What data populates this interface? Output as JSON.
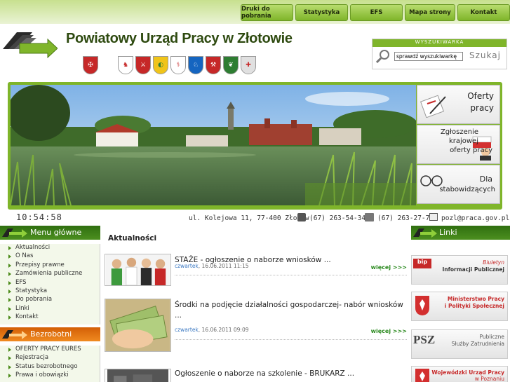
{
  "nav": {
    "items": [
      "Druki do pobrania",
      "Statystyka",
      "EFS",
      "Mapa strony",
      "Kontakt"
    ]
  },
  "header": {
    "title": "Powiatowy Urząd Pracy w Złotowie"
  },
  "search": {
    "heading": "WYSZUKIWARKA",
    "value": "sprawdź wyszukiwarkę",
    "button": "Szukaj"
  },
  "banner": {
    "panels": [
      [
        "Oferty",
        "pracy"
      ],
      [
        "Zgłoszenie",
        "krajowej",
        "oferty pracy"
      ],
      [
        "Dla",
        "stabowidzących"
      ]
    ]
  },
  "info": {
    "time": "10:54:58",
    "address": "ul. Kolejowa 11, 77-400 Złotów",
    "phone": "(67) 263-54-34",
    "fax": "(67) 263-27-79",
    "email": "pozl@praca.gov.pl"
  },
  "menu_main": {
    "heading": "Menu główne",
    "items": [
      "Aktualności",
      "O Nas",
      "Przepisy prawne",
      "Zamówienia publiczne",
      "EFS",
      "Statystyka",
      "Do pobrania",
      "Linki",
      "Kontakt"
    ]
  },
  "menu_unemployed": {
    "heading": "Bezrobotni",
    "items": [
      "OFERTY PRACY EURES",
      "Rejestracja",
      "Status bezrobotnego",
      "Prawa i obowiązki"
    ]
  },
  "news": {
    "heading": "Aktualności",
    "items": [
      {
        "title": "STAŻE - ogłoszenie o naborze wniosków ...",
        "day": "czwartek",
        "datetime": ", 16.06.2011 11:15",
        "more": "więcej >>>"
      },
      {
        "title": "Środki na podjęcie działalności gospodarczej- nabór wniosków ...",
        "day": "czwartek",
        "datetime": ", 16.06.2011 09:09",
        "more": "więcej >>>"
      },
      {
        "title": "Ogłoszenie o naborze na szkolenie - BRUKARZ ...",
        "day": "",
        "datetime": "",
        "more": ""
      }
    ]
  },
  "links": {
    "heading": "Linki",
    "items": [
      {
        "badge": "bip",
        "lines": [
          "Biuletyn",
          "Informacji Publicznej"
        ]
      },
      {
        "badge": "",
        "lines": [
          "Ministerstwo Pracy",
          "i Polityki Społecznej"
        ]
      },
      {
        "badge": "PSZ",
        "lines": [
          "Publiczne",
          "Służby Zatrudnienia"
        ]
      },
      {
        "badge": "",
        "lines": [
          "Wojewódzki Urząd Pracy",
          "w Poznaniu"
        ]
      }
    ]
  },
  "colors": {
    "accent": "#7fb52a",
    "dark_green": "#2e4a10",
    "orange": "#e8730f",
    "link_blue": "#3b78c2"
  }
}
